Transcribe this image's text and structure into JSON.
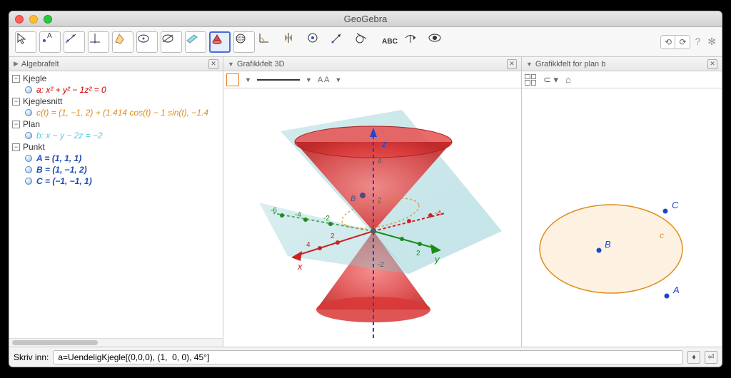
{
  "title": "GeoGebra",
  "panels": {
    "algebra": "Algebrafelt",
    "g3d": "Grafikkfelt 3D",
    "plan": "Grafikkfelt for plan b"
  },
  "categories": {
    "kjegle": "Kjegle",
    "kjeglesnitt": "Kjeglesnitt",
    "plan": "Plan",
    "punkt": "Punkt"
  },
  "items": {
    "a": "a: x² + y² − 1z² = 0",
    "c": "c(t) = (1, −1, 2) + (1.414 cos(t) − 1 sin(t), −1.4",
    "b": "b: x − y − 2z = −2",
    "A": "A = (1, 1, 1)",
    "B": "B = (1, −1, 2)",
    "C": "C = (−1, −1, 1)"
  },
  "colors": {
    "a": "#cc0000",
    "c": "#e08c1b",
    "b": "#5cc8d8",
    "pt": "#1a4db3"
  },
  "g3d_axes": {
    "x": "x",
    "y": "y",
    "z": "z",
    "ticks_neg": [
      "-6",
      "-4",
      "-2"
    ],
    "ticks_pos": [
      "2",
      "4"
    ],
    "z_ticks": [
      "-2",
      "2",
      "4"
    ]
  },
  "plan_pts": {
    "A": "A",
    "B": "B",
    "C": "C",
    "c": "c"
  },
  "g3d_style": {
    "font_opt": "A A"
  },
  "input": {
    "label": "Skriv inn:",
    "value": "a=UendeligKjegle[(0,0,0), (1,  0, 0), 45°]"
  },
  "toolbar_text": {
    "abc": "ABC"
  }
}
